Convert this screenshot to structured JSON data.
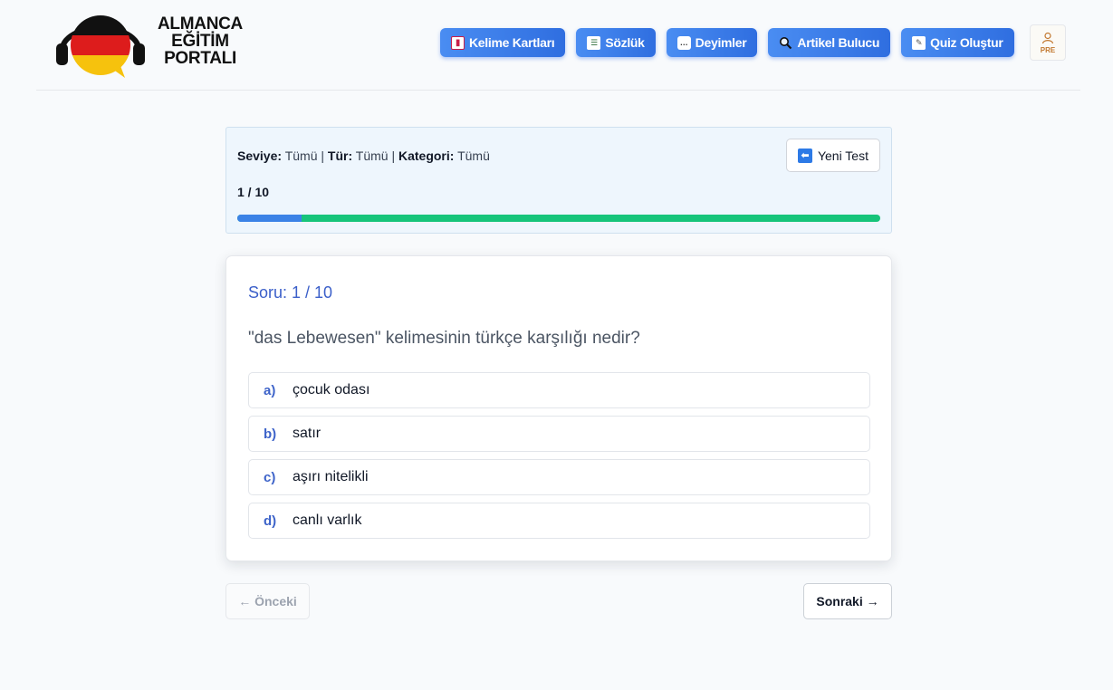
{
  "logo": {
    "line1": "ALMANCA",
    "line2": "EĞİTİM",
    "line3": "PORTALI",
    "flag_colors": [
      "#111111",
      "#dd1c1c",
      "#f6c20d"
    ]
  },
  "nav": {
    "items": [
      {
        "label": "Kelime Kartları",
        "icon": "card-icon"
      },
      {
        "label": "Sözlük",
        "icon": "books-icon"
      },
      {
        "label": "Deyimler",
        "icon": "speech-bubble-icon"
      },
      {
        "label": "Artikel Bulucu",
        "icon": "magnifier-icon"
      },
      {
        "label": "Quiz Oluştur",
        "icon": "memo-icon"
      }
    ],
    "accent": "#3b82f6"
  },
  "profile": {
    "label": "PRE",
    "icon": "user-icon"
  },
  "status": {
    "seviye_label": "Seviye:",
    "seviye_value": "Tümü",
    "tur_label": "Tür:",
    "tur_value": "Tümü",
    "kategori_label": "Kategori:",
    "kategori_value": "Tümü",
    "separator": "|",
    "counter": "1 / 10",
    "progress_fraction": 0.1,
    "new_test_label": "Yeni Test",
    "new_test_icon": "back-arrow-icon"
  },
  "question": {
    "number_text": "Soru: 1 / 10",
    "text": "\"das Lebewesen\" kelimesinin türkçe karşılığı nedir?",
    "options": [
      {
        "letter": "a)",
        "text": "çocuk odası"
      },
      {
        "letter": "b)",
        "text": "satır"
      },
      {
        "letter": "c)",
        "text": "aşırı nitelikli"
      },
      {
        "letter": "d)",
        "text": "canlı varlık"
      }
    ]
  },
  "footer": {
    "prev_label": "← Önceki",
    "next_label": "Sonraki →"
  }
}
